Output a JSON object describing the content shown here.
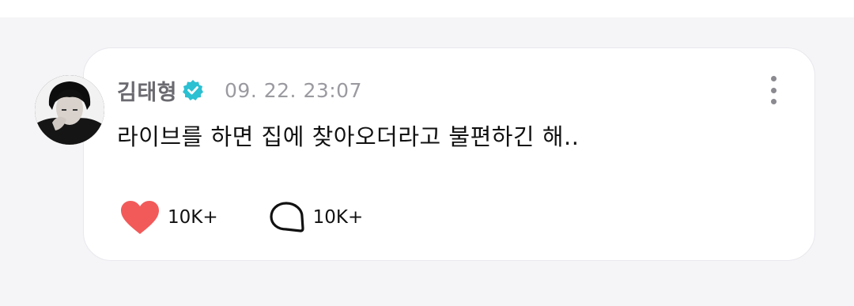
{
  "colors": {
    "background": "#f5f5f7",
    "card": "#ffffff",
    "verified_badge": "#2bc0d2",
    "like_heart": "#f25a5a"
  },
  "post": {
    "author": "김태형",
    "timestamp": "09. 22. 23:07",
    "message": "라이브를 하면 집에 찾아오더라고 불편하긴 해..",
    "likes": "10K+",
    "comments": "10K+",
    "icons": {
      "verified": "verified-badge-icon",
      "more": "more-vertical-icon",
      "like": "heart-icon",
      "comment": "speech-bubble-icon"
    }
  }
}
